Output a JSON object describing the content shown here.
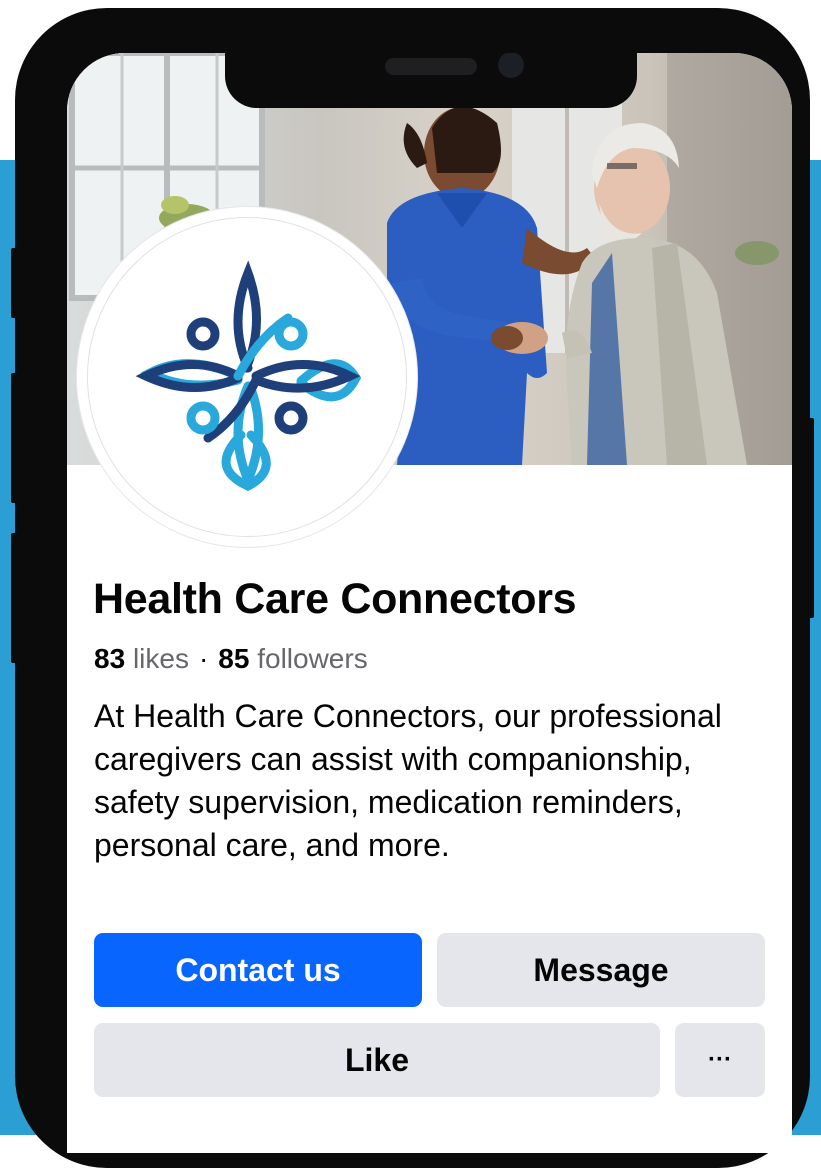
{
  "page": {
    "name": "Health Care Connectors",
    "likes_count": "83",
    "likes_label": "likes",
    "separator": "·",
    "followers_count": "85",
    "followers_label": "followers",
    "bio": "At Health Care Connectors, our professional caregivers can assist with companionship, safety supervision, medication reminders, personal care, and more."
  },
  "actions": {
    "contact_label": "Contact us",
    "message_label": "Message",
    "like_label": "Like",
    "more_label": "···"
  },
  "cover": {
    "subject": "caregiver in blue scrubs holding hands with elderly man"
  },
  "logo": {
    "icon": "interlocking-figures-logo",
    "colors": {
      "dark": "#1f3f7a",
      "light": "#29a8dc"
    }
  },
  "theme": {
    "background_band": "#2b9fd4",
    "primary_button": "#0866ff",
    "secondary_button": "#e4e6eb",
    "text": "#050505",
    "muted_text": "#65676b"
  }
}
